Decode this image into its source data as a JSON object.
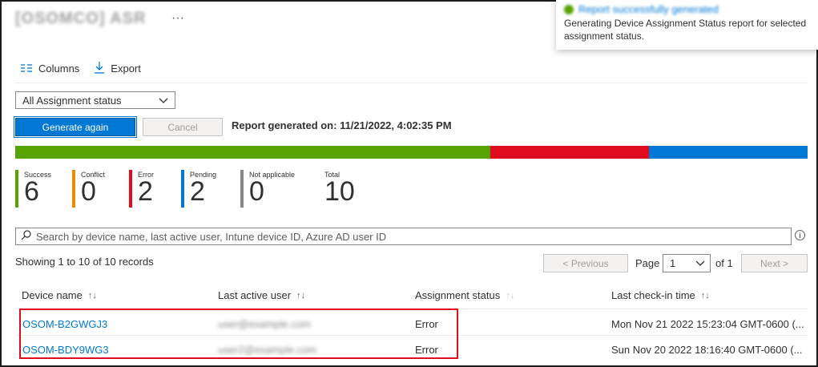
{
  "header": {
    "title": "[OSOMCO] ASR",
    "more_label": "···"
  },
  "toast": {
    "title": "Report successfully generated",
    "body": "Generating Device Assignment Status report for selected assignment status."
  },
  "toolbar": {
    "columns_label": "Columns",
    "export_label": "Export"
  },
  "filter": {
    "assignment_status_value": "All Assignment status"
  },
  "actions": {
    "generate_label": "Generate again",
    "cancel_label": "Cancel",
    "report_generated": "Report generated on: 11/21/2022, 4:02:35 PM"
  },
  "summary": {
    "distribution": {
      "success": 6,
      "error": 2,
      "pending": 2
    },
    "colors": {
      "success": "#57a300",
      "conflict": "#e88c00",
      "error": "#e00b1c",
      "pending": "#0078d4",
      "not_applicable": "#8a8886"
    },
    "counters": [
      {
        "label": "Success",
        "value": "6"
      },
      {
        "label": "Conflict",
        "value": "0"
      },
      {
        "label": "Error",
        "value": "2"
      },
      {
        "label": "Pending",
        "value": "2"
      },
      {
        "label": "Not applicable",
        "value": "0"
      },
      {
        "label": "Total",
        "value": "10"
      }
    ]
  },
  "search": {
    "placeholder": "Search by device name, last active user, Intune device ID, Azure AD user ID"
  },
  "records": {
    "showing": "Showing 1 to 10 of 10 records"
  },
  "pagination": {
    "previous_label": "< Previous",
    "page_label": "Page",
    "current_page": "1",
    "of_label": "of 1",
    "next_label": "Next >"
  },
  "table": {
    "columns": [
      "Device name",
      "Last active user",
      "Assignment status",
      "Last check-in time"
    ],
    "rows": [
      {
        "device": "OSOM-B2GWGJ3",
        "user": "user@example.com",
        "status": "Error",
        "checkin": "Mon Nov 21 2022 15:23:04 GMT-0600 (..."
      },
      {
        "device": "OSOM-BDY9WG3",
        "user": "user2@example.com",
        "status": "Error",
        "checkin": "Sun Nov 20 2022 18:16:40 GMT-0600 (..."
      }
    ]
  }
}
